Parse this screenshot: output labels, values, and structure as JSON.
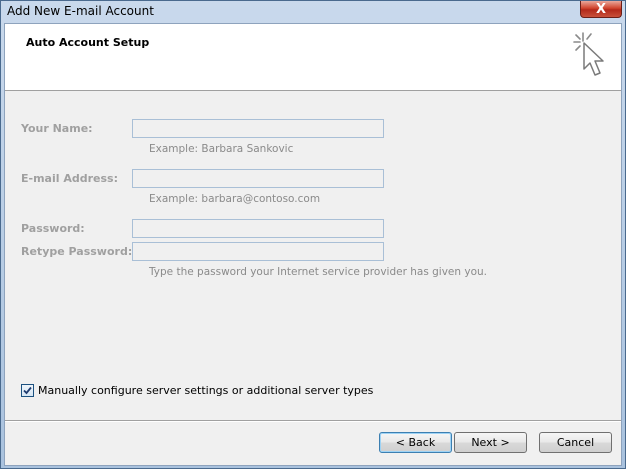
{
  "window": {
    "title": "Add New E-mail Account",
    "close_label": "X"
  },
  "header": {
    "title": "Auto Account Setup",
    "icon": "cursor-click-icon"
  },
  "form": {
    "name": {
      "label": "Your Name:",
      "value": "",
      "hint": "Example: Barbara Sankovic"
    },
    "email": {
      "label": "E-mail Address:",
      "value": "",
      "hint": "Example: barbara@contoso.com"
    },
    "password": {
      "label": "Password:",
      "value": ""
    },
    "retype_password": {
      "label": "Retype Password:",
      "value": ""
    },
    "password_hint": "Type the password your Internet service provider has given you."
  },
  "manual_config": {
    "label": "Manually configure server settings or additional server types",
    "checked": true
  },
  "buttons": {
    "back": "< Back",
    "next": "Next >",
    "cancel": "Cancel"
  }
}
